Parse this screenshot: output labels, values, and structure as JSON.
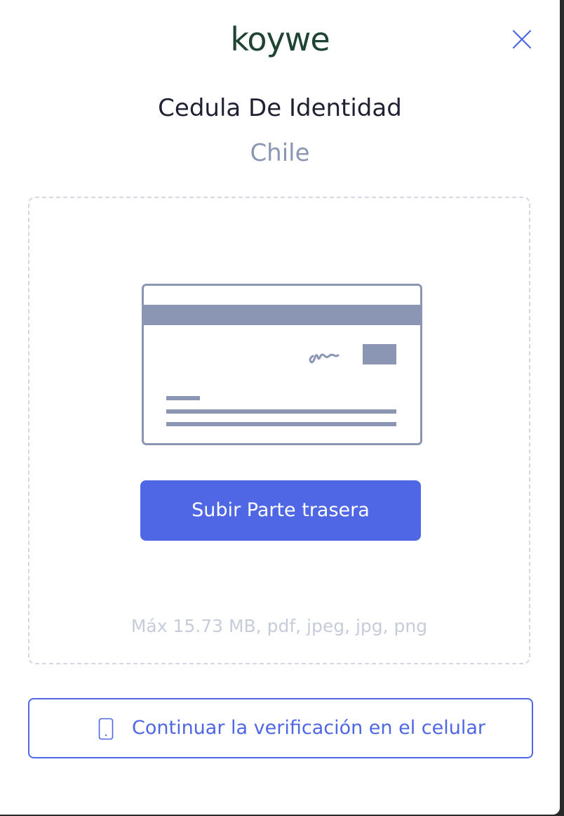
{
  "brand": {
    "logo_text": "koywe",
    "logo_color": "#1f4433"
  },
  "header": {
    "close_icon": "close-icon"
  },
  "document": {
    "title": "Cedula De Identidad",
    "country": "Chile"
  },
  "upload": {
    "illustration_icon": "id-card-back-icon",
    "button_label": "Subir Parte trasera",
    "hint": "Máx 15.73 MB, pdf, jpeg, jpg, png"
  },
  "mobile": {
    "icon": "mobile-phone-icon",
    "label": "Continuar la verificación en el celular"
  },
  "colors": {
    "accent": "#4f67e4",
    "muted": "#8a96b4",
    "illustration": "#8a96b4"
  }
}
